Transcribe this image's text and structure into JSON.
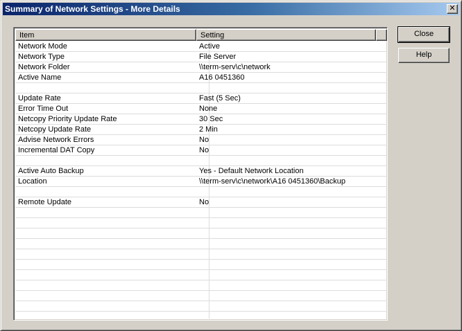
{
  "window": {
    "title": "Summary of Network Settings - More Details",
    "close_glyph": "✕"
  },
  "list": {
    "columns": [
      "Item",
      "Setting"
    ],
    "rows": [
      {
        "item": "Network Mode",
        "setting": "Active"
      },
      {
        "item": "Network Type",
        "setting": "File Server"
      },
      {
        "item": "Network Folder",
        "setting": "\\\\term-serv\\c\\network"
      },
      {
        "item": "Active Name",
        "setting": "A16 0451360"
      },
      {
        "item": "",
        "setting": ""
      },
      {
        "item": "Update Rate",
        "setting": "Fast (5 Sec)"
      },
      {
        "item": "Error Time Out",
        "setting": "None"
      },
      {
        "item": "Netcopy Priority Update Rate",
        "setting": "30 Sec"
      },
      {
        "item": "Netcopy Update Rate",
        "setting": "2 Min"
      },
      {
        "item": "Advise Network Errors",
        "setting": "No"
      },
      {
        "item": "Incremental DAT Copy",
        "setting": "No"
      },
      {
        "item": "",
        "setting": ""
      },
      {
        "item": "Active Auto Backup",
        "setting": "Yes - Default Network Location"
      },
      {
        "item": "Location",
        "setting": "\\\\term-serv\\c\\network\\A16 0451360\\Backup"
      },
      {
        "item": "",
        "setting": ""
      },
      {
        "item": "Remote Update",
        "setting": "No"
      }
    ],
    "total_rows": 29
  },
  "buttons": {
    "close_label": "Close",
    "help_label": "Help"
  }
}
